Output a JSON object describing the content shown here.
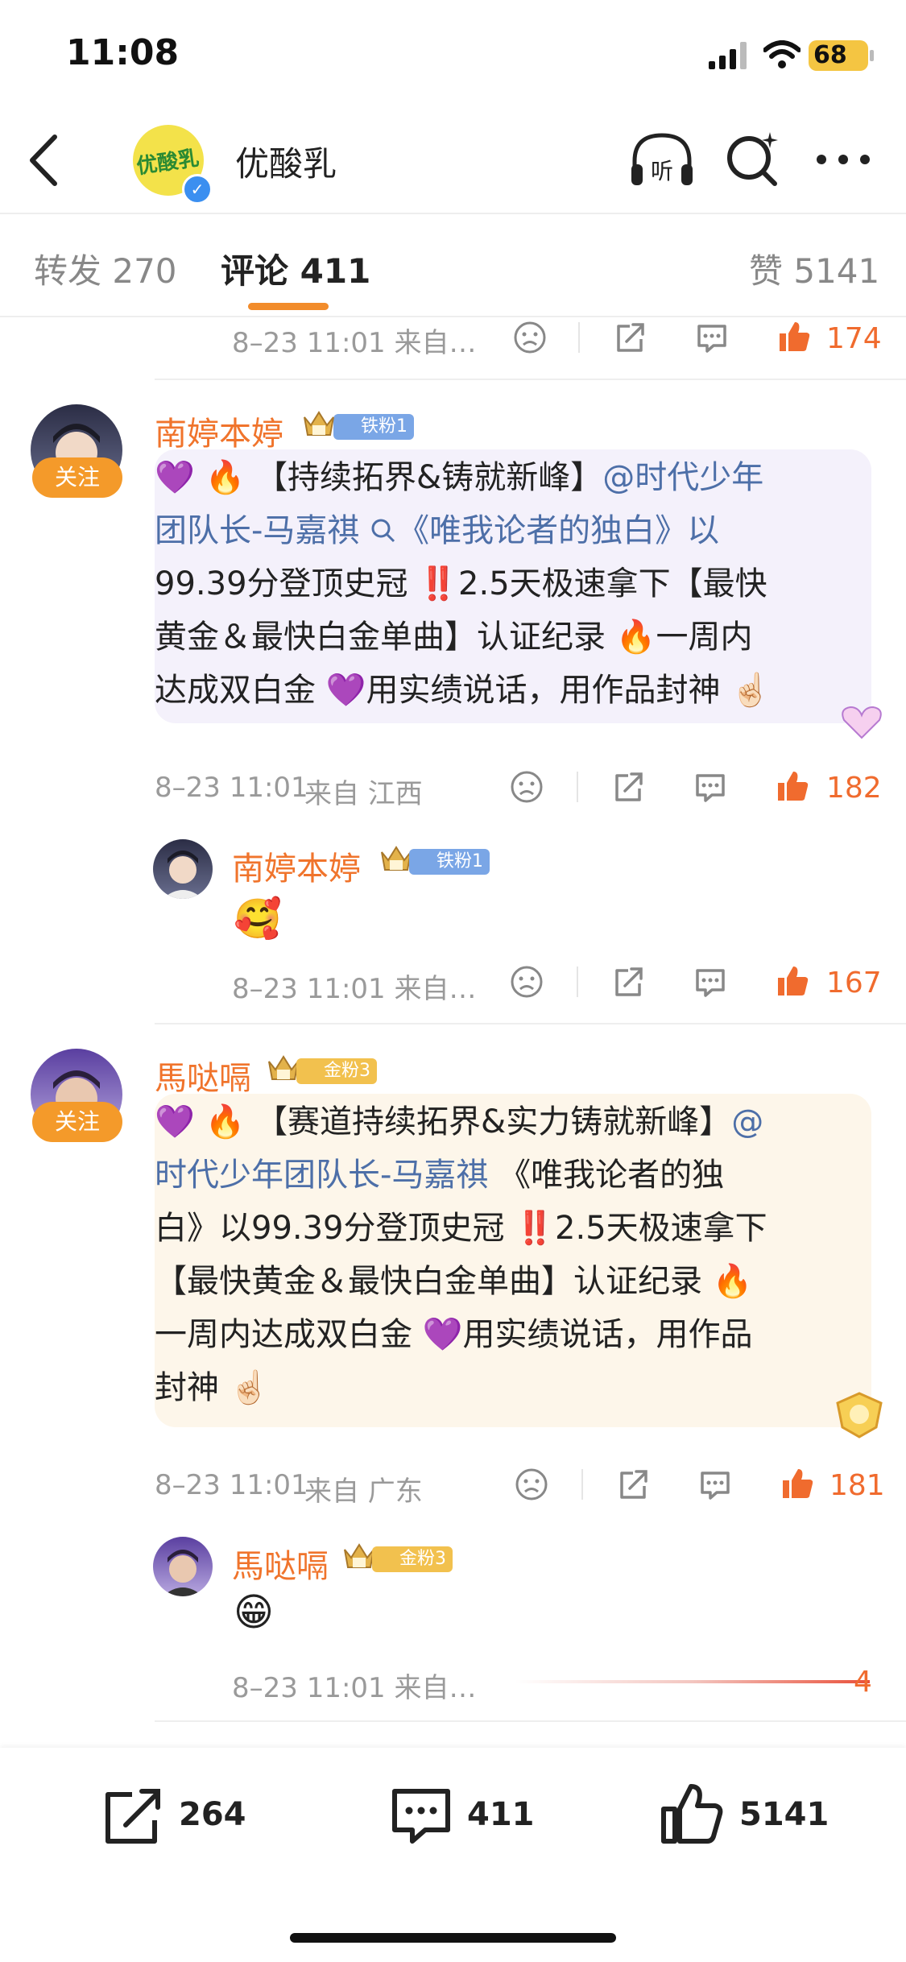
{
  "status_bar": {
    "time": "11:08",
    "battery": "68"
  },
  "header": {
    "account_name": "优酸乳",
    "logo_text": "优酸乳"
  },
  "tabs": [
    {
      "label": "转发 270"
    },
    {
      "label": "评论 411"
    },
    {
      "label": "赞 5141"
    }
  ],
  "colors": {
    "accent": "#f0742c",
    "link": "#4d6fa8",
    "follow": "#f49a2a"
  },
  "comments": {
    "prev_meta": {
      "time_source": "8–23 11:01 来自…",
      "likes": "174"
    },
    "c1": {
      "user": "南婷本婷",
      "badge": "铁粉1",
      "follow": "关注",
      "lines": [
        {
          "pre": "",
          "link": "",
          "post": "【持续拓界&铸就新峰】",
          "link2": "@时代少年"
        },
        {
          "link": "团队长-马嘉祺 ",
          "post": "《唯我论者的独白》以"
        },
        {
          "text": "99.39分登顶史冠 ‼️2.5天极速拿下【最快"
        },
        {
          "text": "黄金＆最快白金单曲】认证纪录 🔥一周内"
        },
        {
          "text": "达成双白金 💜用实绩说话，用作品封神 ☝🏻"
        }
      ],
      "meta": {
        "time": "8–23 11:01",
        "source": "来自 江西",
        "likes": "182"
      },
      "reply": {
        "user": "南婷本婷",
        "badge": "铁粉1",
        "emoji": "🥰",
        "meta": {
          "time_source": "8–23 11:01 来自…",
          "likes": "167"
        }
      }
    },
    "c2": {
      "user": "馬哒嗝",
      "badge": "金粉3",
      "follow": "关注",
      "lines": [
        {
          "post": "【赛道持续拓界&实力铸就新峰】",
          "link2": "@"
        },
        {
          "link": "时代少年团队长-马嘉祺 ",
          "post": "《唯我论者的独"
        },
        {
          "text": "白》以99.39分登顶史冠 ‼️2.5天极速拿下"
        },
        {
          "text": "【最快黄金＆最快白金单曲】认证纪录 🔥"
        },
        {
          "text": "一周内达成双白金 💜用实绩说话，用作品"
        },
        {
          "text": "封神 ☝🏻"
        }
      ],
      "meta": {
        "time": "8–23 11:01",
        "source": "来自 广东",
        "likes": "181"
      },
      "reply": {
        "user": "馬哒嗝",
        "badge": "金粉3",
        "emoji": "😁",
        "meta": {
          "time_source": "8–23 11:01 来自…",
          "likes": "4"
        }
      }
    }
  },
  "bottom_bar": {
    "reposts": "264",
    "comments": "411",
    "likes": "5141"
  },
  "icons": {
    "back": "chevron-left-icon",
    "listen": "headphones-listen-icon",
    "search": "search-sparkle-icon",
    "more": "more-dots-icon",
    "dislike": "frown-icon",
    "share": "share-icon",
    "comment": "comment-bubble-icon",
    "like": "thumb-up-icon"
  }
}
